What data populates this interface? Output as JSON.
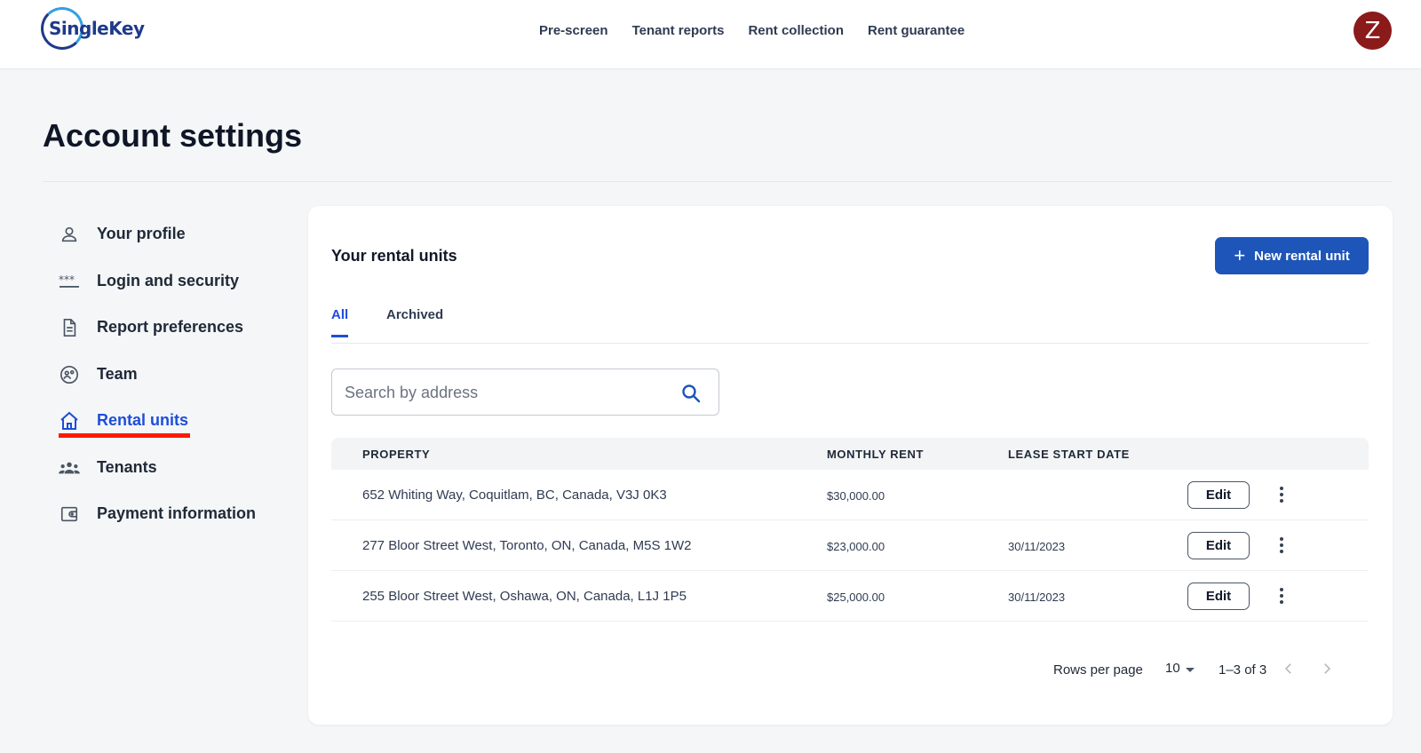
{
  "header": {
    "logo_text": "SingleKey",
    "nav": [
      "Pre-screen",
      "Tenant reports",
      "Rent collection",
      "Rent guarantee"
    ],
    "avatar_initial": "Z"
  },
  "page": {
    "title": "Account settings"
  },
  "sidebar": {
    "items": [
      {
        "label": "Your profile",
        "icon": "person-icon"
      },
      {
        "label": "Login and security",
        "icon": "password-icon"
      },
      {
        "label": "Report preferences",
        "icon": "document-icon"
      },
      {
        "label": "Team",
        "icon": "team-icon"
      },
      {
        "label": "Rental units",
        "icon": "home-icon",
        "active": true
      },
      {
        "label": "Tenants",
        "icon": "group-icon"
      },
      {
        "label": "Payment information",
        "icon": "wallet-icon"
      }
    ]
  },
  "rental_units": {
    "title": "Your rental units",
    "new_button_label": "New rental unit",
    "tabs": [
      "All",
      "Archived"
    ],
    "active_tab": "All",
    "search": {
      "placeholder": "Search by address",
      "value": ""
    },
    "columns": [
      "PROPERTY",
      "MONTHLY RENT",
      "LEASE START DATE"
    ],
    "rows": [
      {
        "property": "652 Whiting Way, Coquitlam, BC, Canada, V3J 0K3",
        "rent": "$30,000.00",
        "lease_start": ""
      },
      {
        "property": "277 Bloor Street West, Toronto, ON, Canada, M5S 1W2",
        "rent": "$23,000.00",
        "lease_start": "30/11/2023"
      },
      {
        "property": "255 Bloor Street West, Oshawa, ON, Canada, L1J 1P5",
        "rent": "$25,000.00",
        "lease_start": "30/11/2023"
      }
    ],
    "edit_label": "Edit",
    "pagination": {
      "rows_per_page_label": "Rows per page",
      "rows_per_page": "10",
      "range": "1–3 of 3"
    }
  },
  "colors": {
    "accent": "#1d4ed8",
    "button": "#1e55b8",
    "avatar": "#8b1a1a",
    "active_underline": "#ff1a00"
  }
}
